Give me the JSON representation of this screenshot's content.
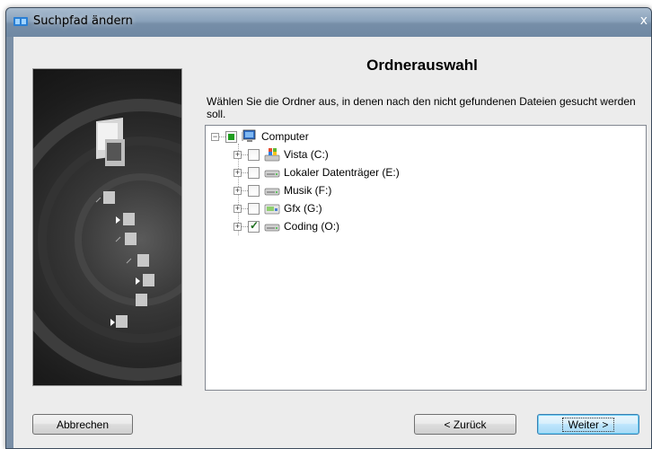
{
  "window": {
    "title": "Suchpfad ändern",
    "close_glyph": "x"
  },
  "main": {
    "heading": "Ordnerauswahl",
    "description": "Wählen Sie die Ordner aus, in denen nach den nicht gefundenen Dateien gesucht werden soll."
  },
  "tree": {
    "root": {
      "label": "Computer",
      "expander": "−",
      "check": "partial",
      "icon": "computer-icon"
    },
    "items": [
      {
        "label": "Vista (C:)",
        "expander": "+",
        "check": "unchecked",
        "icon": "windows-drive-icon"
      },
      {
        "label": "Lokaler Datenträger (E:)",
        "expander": "+",
        "check": "unchecked",
        "icon": "hard-drive-icon"
      },
      {
        "label": "Musik (F:)",
        "expander": "+",
        "check": "unchecked",
        "icon": "hard-drive-icon"
      },
      {
        "label": "Gfx (G:)",
        "expander": "+",
        "check": "unchecked",
        "icon": "drive-32-icon"
      },
      {
        "label": "Coding (O:)",
        "expander": "+",
        "check": "checked",
        "icon": "hard-drive-icon"
      }
    ]
  },
  "buttons": {
    "cancel": "Abbrechen",
    "back": "< Zurück",
    "next": "Weiter >"
  },
  "colors": {
    "titlebar": "#8aa2bb",
    "client_bg": "#ececec",
    "partial_check": "#1f9d1f",
    "default_button": "#bee6fd"
  }
}
